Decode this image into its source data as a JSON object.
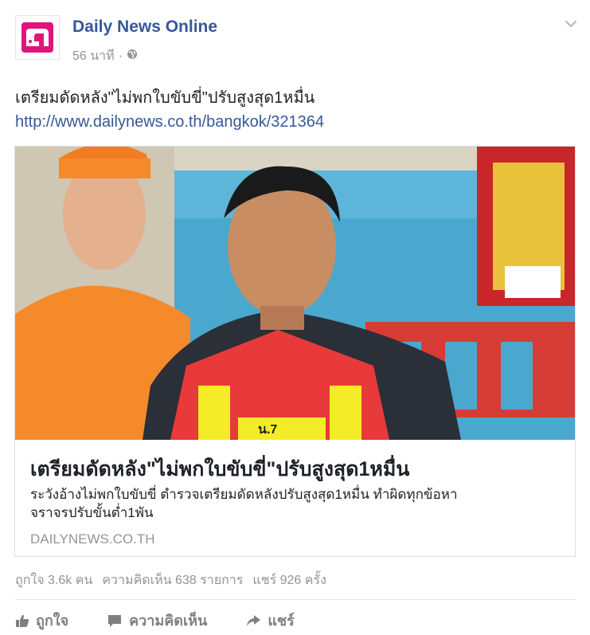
{
  "header": {
    "page_name": "Daily News Online",
    "timestamp": "56 นาที",
    "separator": "·",
    "privacy_icon": "globe-icon",
    "menu_icon": "chevron-down-icon"
  },
  "post": {
    "text": "เตรียมดัดหลัง\"ไม่พกใบขับขี่\"ปรับสูงสุด1หมื่น",
    "link": "http://www.dailynews.co.th/bangkok/321364"
  },
  "card": {
    "title": "เตรียมดัดหลัง\"ไม่พกใบขับขี่\"ปรับสูงสุด1หมื่น",
    "description_line1": "ระวังอ้างไม่พกใบขับขี่ ตำรวจเตรียมดัดหลังปรับสูงสุด1หมื่น ทำผิดทุกข้อหา",
    "description_line2": "จราจรปรับขั้นต่ำ1พัน",
    "domain": "DAILYNEWS.CO.TH",
    "image_text": {
      "vest_tag": "น.7"
    }
  },
  "stats": {
    "likes": "ถูกใจ 3.6k คน",
    "comments": "ความคิดเห็น 638 รายการ",
    "shares": "แชร์ 926 ครั้ง"
  },
  "actions": {
    "like": "ถูกใจ",
    "comment": "ความคิดเห็น",
    "share": "แชร์"
  },
  "colors": {
    "brand_link": "#365899",
    "muted": "#90949c",
    "logo_pink": "#e0157a",
    "orange_shirt": "#f58a2a",
    "banner_blue": "#4aa8cf"
  }
}
